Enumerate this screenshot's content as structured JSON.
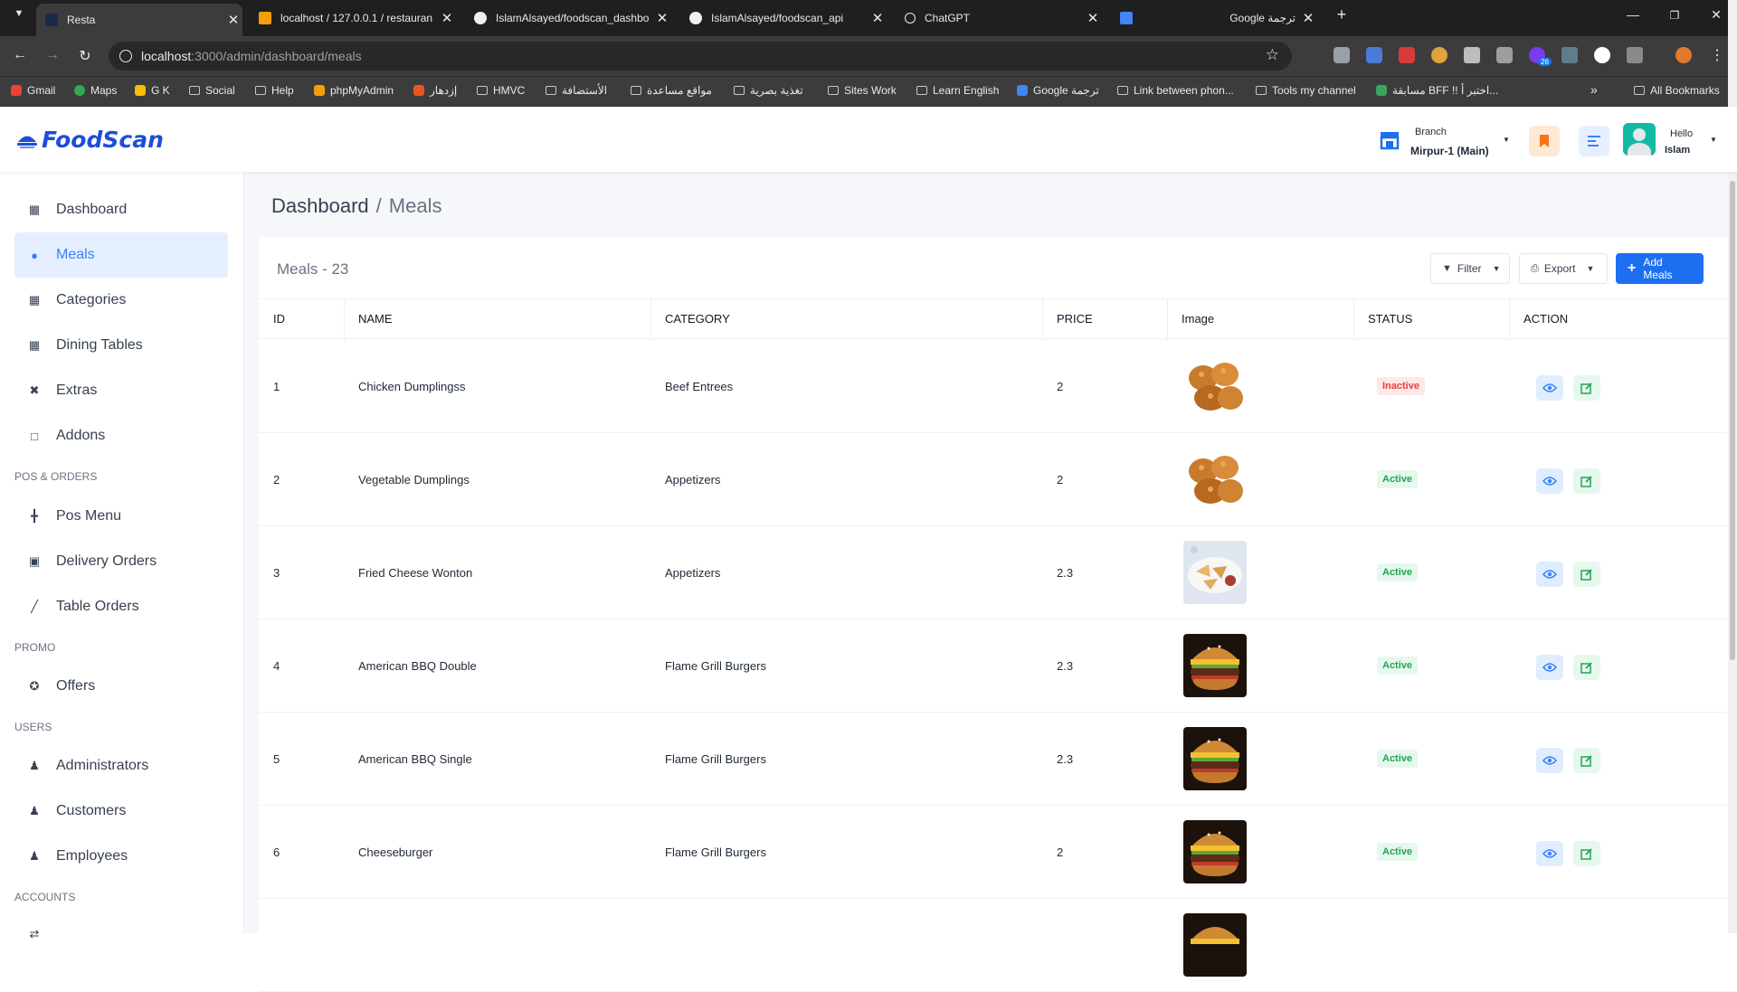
{
  "browser": {
    "tabs": [
      {
        "title": "Resta",
        "active": true
      },
      {
        "title": "localhost / 127.0.0.1 / restauran"
      },
      {
        "title": "IslamAlsayed/foodscan_dashbo"
      },
      {
        "title": "IslamAlsayed/foodscan_api"
      },
      {
        "title": "ChatGPT"
      },
      {
        "title": "Google ترجمة"
      }
    ],
    "address": {
      "host": "localhost",
      "path": ":3000/admin/dashboard/meals"
    },
    "extension_badge": "26",
    "bookmarks": [
      "Gmail",
      "Maps",
      "G K",
      "Social",
      "Help",
      "phpMyAdmin",
      "إزدهار",
      "HMVC",
      "الأستضافة",
      "مواقع مساعدة",
      "تغذية بصرية",
      "Sites Work",
      "Learn English",
      "Google ترجمة",
      "Link between phon...",
      "Tools my channel",
      "مسابقة BFF !! اختبر أ...",
      "All Bookmarks"
    ]
  },
  "header": {
    "logo_text": "FoodScan",
    "branch_label": "Branch",
    "branch_value": "Mirpur-1 (Main)",
    "greeting": "Hello",
    "user_name": "Islam"
  },
  "sidebar": {
    "items": [
      {
        "label": "Dashboard",
        "icon": "dashboard-icon"
      },
      {
        "label": "Meals",
        "icon": "meals-icon",
        "active": true
      },
      {
        "label": "Categories",
        "icon": "categories-icon"
      },
      {
        "label": "Dining Tables",
        "icon": "dining-tables-icon"
      },
      {
        "label": "Extras",
        "icon": "extras-icon"
      },
      {
        "label": "Addons",
        "icon": "addons-icon"
      },
      {
        "label": "Pos Menu",
        "icon": "pos-menu-icon"
      },
      {
        "label": "Delivery Orders",
        "icon": "delivery-orders-icon"
      },
      {
        "label": "Table Orders",
        "icon": "table-orders-icon"
      },
      {
        "label": "Offers",
        "icon": "offers-icon"
      },
      {
        "label": "Administrators",
        "icon": "administrators-icon"
      },
      {
        "label": "Customers",
        "icon": "customers-icon"
      },
      {
        "label": "Employees",
        "icon": "employees-icon"
      }
    ],
    "sections": [
      "POS & ORDERS",
      "PROMO",
      "USERS",
      "ACCOUNTS"
    ]
  },
  "breadcrumb": {
    "root": "Dashboard",
    "separator": "/",
    "current": "Meals"
  },
  "table": {
    "title": "Meals - 23",
    "filter_label": "Filter",
    "export_label": "Export",
    "add_label": "Add Meals",
    "columns": [
      "ID",
      "NAME",
      "CATEGORY",
      "PRICE",
      "Image",
      "STATUS",
      "ACTION"
    ],
    "rows": [
      {
        "id": "1",
        "name": "Chicken Dumplingss",
        "category": "Beef Entrees",
        "price": "2",
        "image": "fried-chicken",
        "status": "Inactive"
      },
      {
        "id": "2",
        "name": "Vegetable Dumplings",
        "category": "Appetizers",
        "price": "2",
        "image": "fried-chicken",
        "status": "Active"
      },
      {
        "id": "3",
        "name": "Fried Cheese Wonton",
        "category": "Appetizers",
        "price": "2.3",
        "image": "wonton-plate",
        "status": "Active"
      },
      {
        "id": "4",
        "name": "American BBQ Double",
        "category": "Flame Grill Burgers",
        "price": "2.3",
        "image": "burger",
        "status": "Active"
      },
      {
        "id": "5",
        "name": "American BBQ Single",
        "category": "Flame Grill Burgers",
        "price": "2.3",
        "image": "burger",
        "status": "Active"
      },
      {
        "id": "6",
        "name": "Cheeseburger",
        "category": "Flame Grill Burgers",
        "price": "2",
        "image": "burger",
        "status": "Active"
      }
    ]
  },
  "colors": {
    "accent": "#1d6ff2",
    "active_nav_bg": "#e5efff",
    "active_badge_bg": "#e6f8ee",
    "active_badge_text": "#22a454",
    "inactive_badge_bg": "#fde8e8",
    "inactive_badge_text": "#e53e3e"
  }
}
